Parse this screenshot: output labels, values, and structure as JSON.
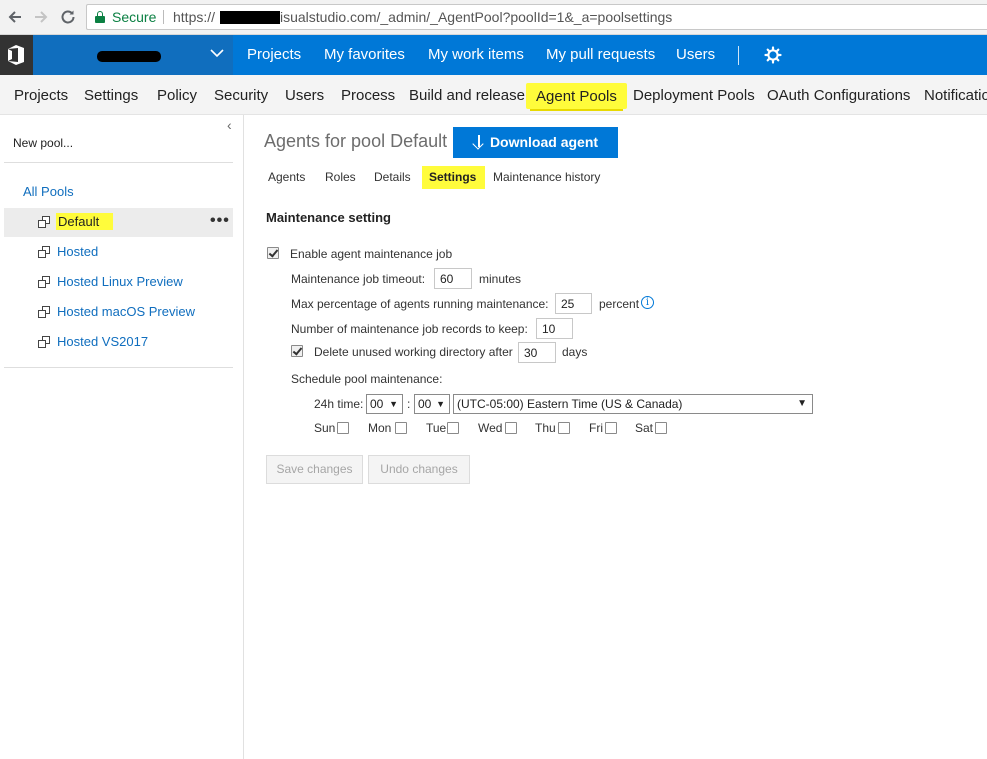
{
  "browser": {
    "secure_label": "Secure",
    "url_scheme": "https://",
    "url_rest": "isualstudio.com/_admin/_AgentPool?poolId=1&_a=poolsettings"
  },
  "header": {
    "hubs": [
      "Projects",
      "My favorites",
      "My work items",
      "My pull requests",
      "Users"
    ]
  },
  "admin_tabs": [
    "Projects",
    "Settings",
    "Policy",
    "Security",
    "Users",
    "Process",
    "Build and release",
    "Agent Pools",
    "Deployment Pools",
    "OAuth Configurations",
    "Notifications"
  ],
  "left_pane": {
    "new_pool": "New pool...",
    "all_pools": "All Pools",
    "pools": [
      "Default",
      "Hosted",
      "Hosted Linux Preview",
      "Hosted macOS Preview",
      "Hosted VS2017"
    ],
    "more": "•••"
  },
  "main": {
    "title": "Agents for pool Default",
    "download_label": "Download agent",
    "tabs": [
      "Agents",
      "Roles",
      "Details",
      "Settings",
      "Maintenance history"
    ],
    "section_title": "Maintenance setting",
    "enable_label": "Enable agent maintenance job",
    "timeout_label": "Maintenance job timeout:",
    "timeout_value": "60",
    "timeout_unit": "minutes",
    "max_pct_label": "Max percentage of agents running maintenance:",
    "max_pct_value": "25",
    "max_pct_unit": "percent",
    "records_label": "Number of maintenance job records to keep:",
    "records_value": "10",
    "delete_label": "Delete unused working directory after",
    "delete_value": "30",
    "delete_unit": "days",
    "schedule_label": "Schedule pool maintenance:",
    "time_label": "24h time:",
    "hour": "00",
    "time_sep": ":",
    "minute": "00",
    "timezone": "(UTC-05:00) Eastern Time (US & Canada)",
    "days": [
      "Sun",
      "Mon",
      "Tue",
      "Wed",
      "Thu",
      "Fri",
      "Sat"
    ],
    "save_label": "Save changes",
    "undo_label": "Undo changes"
  },
  "icons": {
    "dropdown_arrow": "▼",
    "info": "i",
    "collapse": "‹"
  },
  "colors": {
    "brand_blue": "#0078d7",
    "highlight": "#fffc3b",
    "secure_green": "#0b8043"
  }
}
